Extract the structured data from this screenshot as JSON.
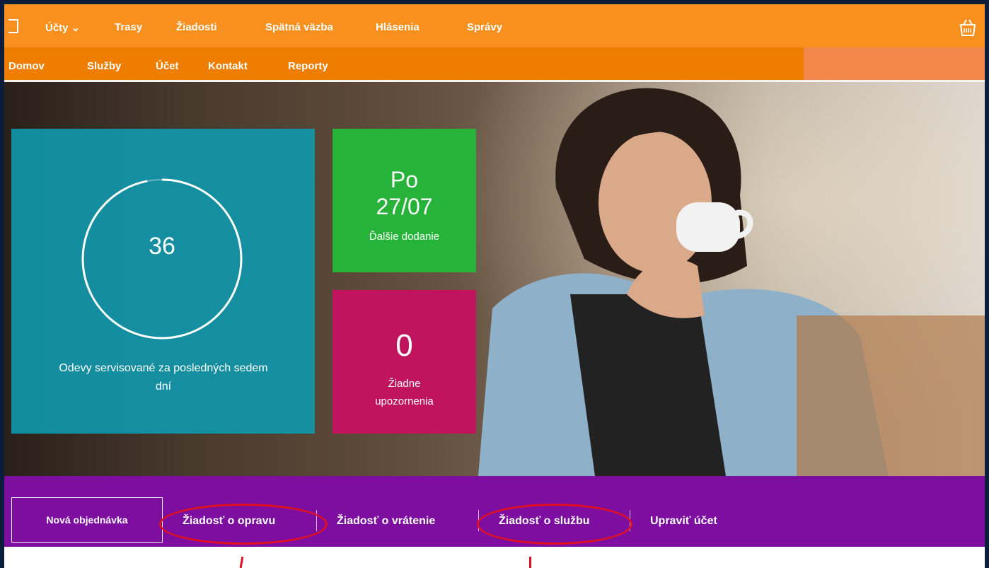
{
  "top_nav": {
    "items": [
      "Účty ⌄",
      "Trasy",
      "Žiadosti",
      "Spätná väzba",
      "Hlásenia",
      "Správy"
    ]
  },
  "sub_nav": {
    "items": [
      "Domov",
      "Služby",
      "Účet",
      "Kontakt",
      "Reporty"
    ]
  },
  "dashboard": {
    "garments": {
      "value": "36",
      "label": "Odevy servisované za posledných sedem dní",
      "progress": 0.97
    },
    "next_delivery": {
      "day": "Po",
      "date": "27/07",
      "label": "Ďalšie dodanie"
    },
    "alerts": {
      "count": "0",
      "label": "Žiadne upozornenia"
    }
  },
  "actions": {
    "primary": "Nová objednávka",
    "items": [
      "Žiadosť o opravu",
      "Žiadosť o vrátenie",
      "Žiadosť o službu",
      "Upraviť účet"
    ]
  },
  "colors": {
    "orange": "#f7901e",
    "teal": "#1096aa",
    "green": "#27b33a",
    "pink": "#c0145f",
    "purple": "#7d0ea0",
    "annotation_red": "#e01020"
  },
  "icons": [
    "home-icon",
    "basket-icon"
  ]
}
